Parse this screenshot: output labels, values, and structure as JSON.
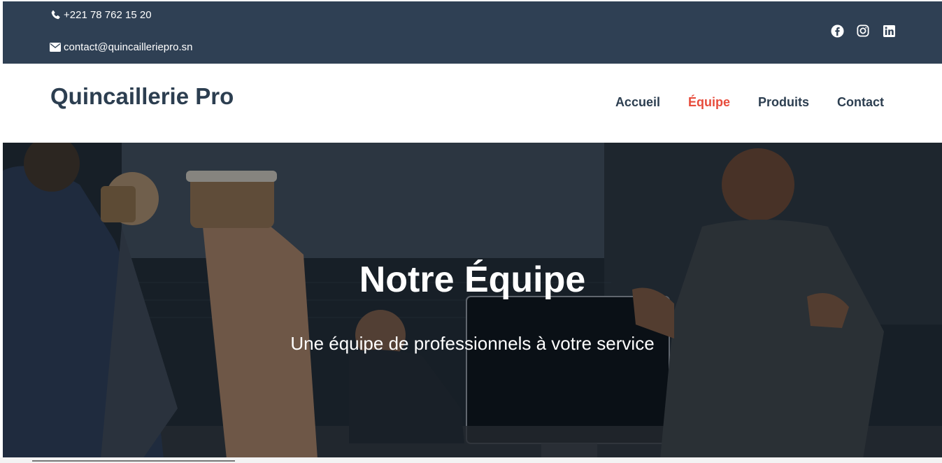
{
  "topbar": {
    "phone": "+221 78 762 15 20",
    "email": "contact@quincailleriepro.sn",
    "social": [
      {
        "icon": "facebook-icon"
      },
      {
        "icon": "instagram-icon"
      },
      {
        "icon": "linkedin-icon"
      }
    ]
  },
  "nav": {
    "brand": "Quincaillerie Pro",
    "items": [
      {
        "label": "Accueil"
      },
      {
        "label": "Équipe"
      },
      {
        "label": "Produits"
      },
      {
        "label": "Contact"
      }
    ],
    "active_index": 1
  },
  "hero": {
    "title": "Notre Équipe",
    "subtitle": "Une équipe de professionnels à votre service"
  },
  "colors": {
    "topbar_bg": "#2f4054",
    "brand": "#2c3e50",
    "active": "#e74c3c"
  }
}
